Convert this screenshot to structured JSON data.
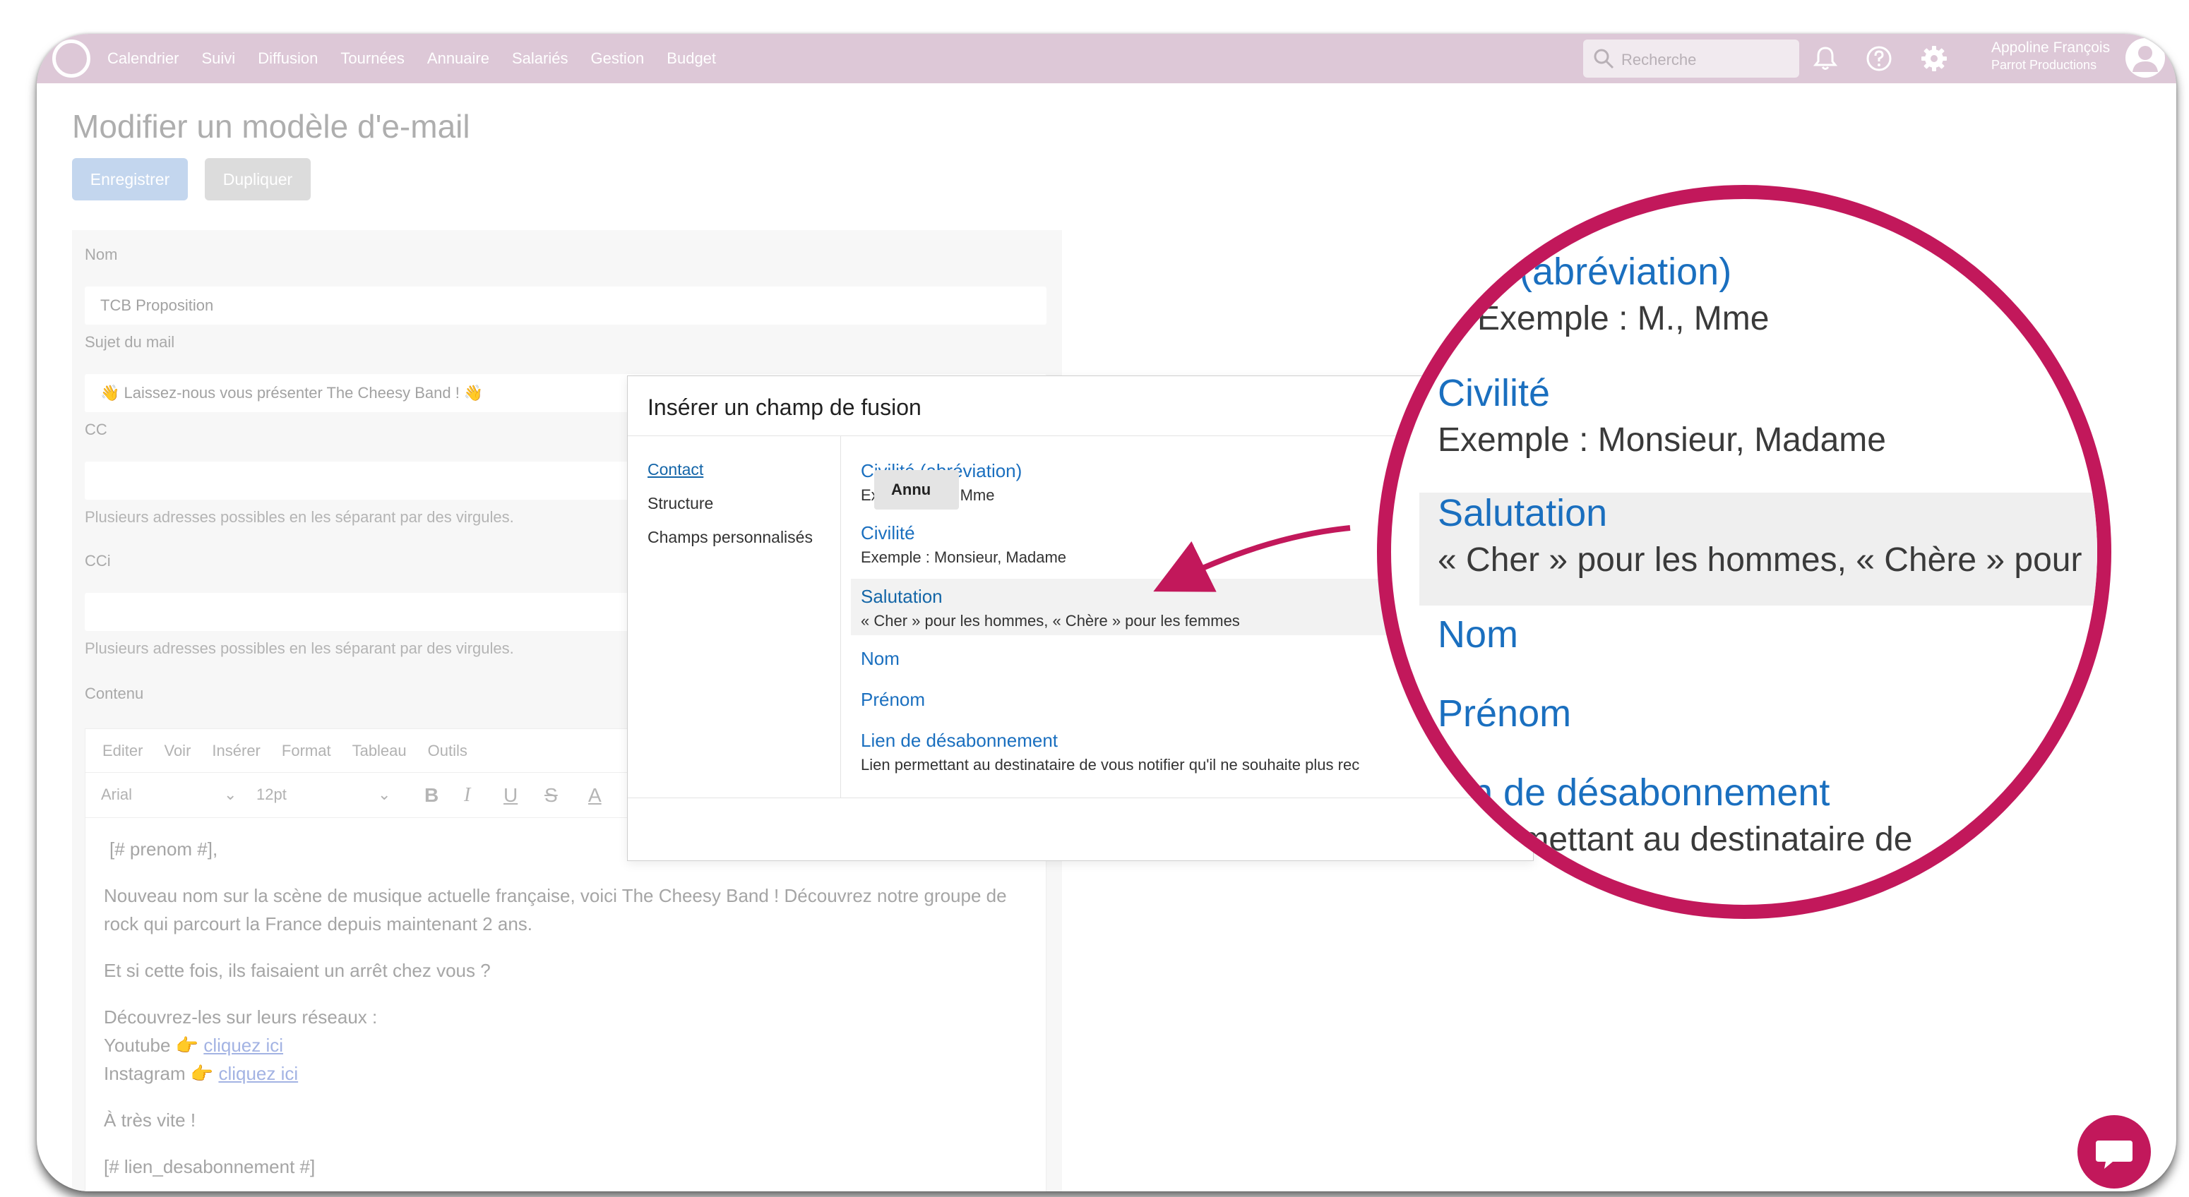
{
  "nav": {
    "items": [
      "Calendrier",
      "Suivi",
      "Diffusion",
      "Tournées",
      "Annuaire",
      "Salariés",
      "Gestion",
      "Budget"
    ],
    "search_placeholder": "Recherche",
    "user_name": "Appoline François",
    "user_company": "Parrot Productions"
  },
  "page": {
    "title": "Modifier un modèle d'e-mail",
    "save_label": "Enregistrer",
    "duplicate_label": "Dupliquer"
  },
  "form": {
    "name_label": "Nom",
    "name_value": "TCB Proposition",
    "subject_label": "Sujet du mail",
    "subject_value": "👋 Laissez-nous vous présenter The Cheesy Band ! 👋",
    "cc_label": "CC",
    "cc_hint": "Plusieurs adresses possibles en les séparant par des virgules.",
    "bcc_label": "CCi",
    "bcc_hint": "Plusieurs adresses possibles en les séparant par des virgules.",
    "content_label": "Contenu"
  },
  "editor": {
    "menus": [
      "Editer",
      "Voir",
      "Insérer",
      "Format",
      "Tableau",
      "Outils"
    ],
    "font": "Arial",
    "size": "12pt",
    "content": {
      "greeting": "[# prenom #],",
      "para1": "Nouveau nom sur la scène de musique actuelle française, voici The Cheesy Band ! Découvrez notre groupe de rock qui parcourt la France depuis maintenant 2 ans.",
      "para2": "Et si cette fois, ils faisaient un arrêt chez vous ?",
      "para3_intro": "Découvrez-les sur leurs réseaux :",
      "youtube": "Youtube 👉",
      "instagram": "Instagram 👉",
      "link_text": "cliquez ici",
      "closing": "À très vite !",
      "unsubscribe_tag": "[# lien_desabonnement #]"
    }
  },
  "modal": {
    "title": "Insérer un champ de fusion",
    "sidebar": [
      "Contact",
      "Structure",
      "Champs personnalisés"
    ],
    "fields": [
      {
        "name": "Civilité (abréviation)",
        "desc": "Exemple : M., Mme"
      },
      {
        "name": "Civilité",
        "desc": "Exemple : Monsieur, Madame"
      },
      {
        "name": "Salutation",
        "desc": "« Cher » pour les hommes, « Chère » pour les femmes"
      },
      {
        "name": "Nom",
        "desc": ""
      },
      {
        "name": "Prénom",
        "desc": ""
      },
      {
        "name": "Lien de désabonnement",
        "desc": "Lien permettant au destinataire de vous notifier qu'il ne souhaite plus rec"
      }
    ],
    "cancel_label": "Annu"
  },
  "magnifier": {
    "field1_name": "té (abréviation)",
    "field1_desc": "Exemple : M., Mme",
    "field2_name": "Civilité",
    "field2_desc": "Exemple : Monsieur, Madame",
    "field3_name": "Salutation",
    "field3_desc": "« Cher » pour les hommes, « Chère » pour",
    "field4_name": "Nom",
    "field5_name": "Prénom",
    "field6_name": "n de désabonnement",
    "field6_desc": "permettant au destinataire de"
  },
  "colors": {
    "topbar": "#ddc8d7",
    "accent": "#c2185b",
    "link": "#1a6fbf"
  }
}
